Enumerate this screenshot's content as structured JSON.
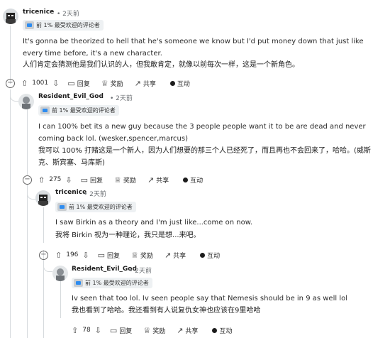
{
  "comments": [
    {
      "username": "tricenice",
      "age": "• 2天前",
      "flair": "前 1% 最受欢迎的评论者",
      "text_en": "It's gonna be theorized to hell that he's someone we know but I'd put money down that just like every time before, it's a new character.",
      "text_zh": "人们肯定会猜测他是我们认识的人，但我敢肯定，就像以前每次一样，这是一个新角色。",
      "votes": "1001",
      "reply": "回复",
      "award": "奖励",
      "share": "共享",
      "interact": "互动"
    },
    {
      "username": "Resident_Evil_God",
      "age": "• 2天前",
      "flair": "前 1% 最受欢迎的评论者",
      "text_en": "I can 100% bet its a new guy because the 3 people people want it to be are dead and never coming back lol. (wesker,spencer,marcus)",
      "text_zh": "我可以 100% 打赌这是一个新人，因为人们想要的那三个人已经死了，而且再也不会回来了，哈哈。(威斯克、斯宾塞、马库斯)",
      "votes": "275",
      "reply": "回复",
      "award": "奖励",
      "share": "共享",
      "interact": "互动"
    },
    {
      "username": "tricenice",
      "age": "• 2天前",
      "flair": "前 1% 最受欢迎的评论者",
      "text_en": "I saw Birkin as a theory and I'm just like...come on now.",
      "text_zh": "我将 Birkin 视为一种理论，我只是想...来吧。",
      "votes": "196",
      "reply": "回复",
      "award": "奖励",
      "share": "共享",
      "interact": "互动"
    },
    {
      "username": "Resident_Evil_God",
      "age": "• 2天前",
      "flair": "前 1% 最受欢迎的评论者",
      "text_en": "Iv seen that too lol. Iv seen people say that Nemesis should be in 9 as well lol",
      "text_zh": "我也看到了哈哈。我还看到有人说复仇女神也应该在9里哈哈",
      "votes": "78",
      "reply": "回复",
      "award": "奖励",
      "share": "共享",
      "interact": "互动"
    }
  ],
  "icons": {
    "upvote": "upvote-icon",
    "downvote": "downvote-icon",
    "reply": "comment-icon",
    "award": "award-icon",
    "share": "share-icon",
    "collapse": "collapse-icon"
  },
  "colors": {
    "thread_line": "#d6dadd",
    "flair_bg": "#eef1f3",
    "meta": "#6b6f73"
  }
}
